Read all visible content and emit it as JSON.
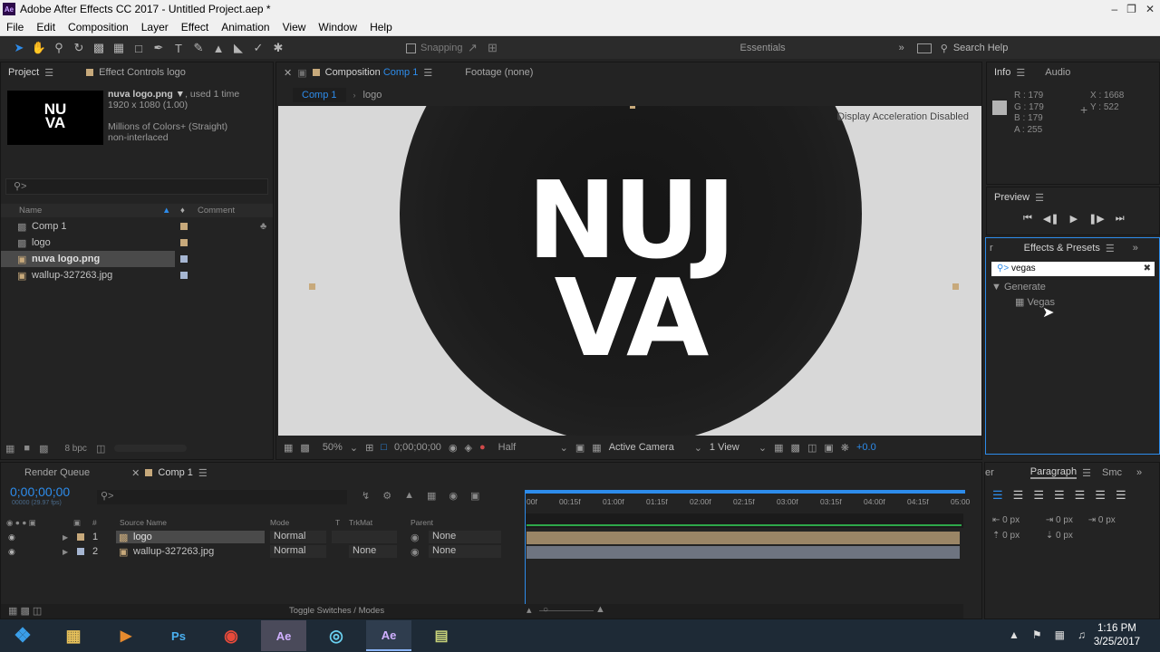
{
  "window": {
    "title": "Adobe After Effects CC 2017 - Untitled Project.aep *",
    "app_icon": "Ae"
  },
  "menu": [
    "File",
    "Edit",
    "Composition",
    "Layer",
    "Effect",
    "Animation",
    "View",
    "Window",
    "Help"
  ],
  "toolbar": {
    "snapping": "Snapping",
    "workspace": "Essentials",
    "search_help": "Search Help"
  },
  "project": {
    "tab": "Project",
    "effect_controls_tab": "Effect Controls logo",
    "thumb_text": [
      "NU",
      "VA"
    ],
    "file_name": "nuva logo.png",
    "used": ", used 1 time",
    "dims": "1920 x 1080 (1.00)",
    "colors": "Millions of Colors+ (Straight)",
    "interlace": "non-interlaced",
    "search_placeholder": "",
    "col_name": "Name",
    "col_comment": "Comment",
    "items": [
      {
        "name": "Comp 1",
        "color": "#c7a97b",
        "selected": false
      },
      {
        "name": "logo",
        "color": "#c7a97b",
        "selected": false
      },
      {
        "name": "nuva logo.png",
        "color": "#a6b6d2",
        "selected": true
      },
      {
        "name": "wallup-327263.jpg",
        "color": "#a6b6d2",
        "selected": false
      }
    ],
    "bpc": "8 bpc"
  },
  "composition": {
    "tab_prefix": "Composition",
    "tab_name": "Comp 1",
    "footage_tab": "Footage (none)",
    "crumb1": "Comp 1",
    "crumb2": "logo",
    "display_msg": "Display Acceleration Disabled",
    "logo_line1": "NUJ",
    "logo_line2": "VA",
    "zoom": "50%",
    "timecode": "0;00;00;00",
    "resolution": "Half",
    "camera": "Active Camera",
    "view": "1 View",
    "exposure": "+0.0"
  },
  "info": {
    "tab": "Info",
    "audio_tab": "Audio",
    "r": "R : 179",
    "g": "G : 179",
    "b": "B : 179",
    "a": "A : 255",
    "x": "X : 1668",
    "y": "Y : 522"
  },
  "preview": {
    "tab": "Preview"
  },
  "effects": {
    "tab": "Effects & Presets",
    "left_tab_fragment": "r",
    "search_value": "vegas",
    "category": "Generate",
    "item": "Vegas"
  },
  "timeline": {
    "render_tab": "Render Queue",
    "comp_tab": "Comp 1",
    "timecode": "0;00;00;00",
    "fps": "00000 (29.97 fps)",
    "ticks": [
      "00f",
      "00:15f",
      "01:00f",
      "01:15f",
      "02:00f",
      "02:15f",
      "03:00f",
      "03:15f",
      "04:00f",
      "04:15f",
      "05:00"
    ],
    "cols": {
      "hash": "#",
      "source": "Source Name",
      "mode": "Mode",
      "t": "T",
      "trkmat": "TrkMat",
      "parent": "Parent"
    },
    "layers": [
      {
        "num": "1",
        "name": "logo",
        "mode": "Normal",
        "trkmat": "",
        "parent": "None",
        "color": "#c7a97b"
      },
      {
        "num": "2",
        "name": "wallup-327263.jpg",
        "mode": "Normal",
        "trkmat": "None",
        "parent": "None",
        "color": "#a6b6d2"
      }
    ],
    "toggle": "Toggle Switches / Modes"
  },
  "paragraph": {
    "tab": "Paragraph",
    "smc_tab": "Smc",
    "left_fragment": "er",
    "values": [
      "0 px",
      "0 px",
      "0 px",
      "0 px",
      "0 px"
    ]
  },
  "taskbar": {
    "apps": [
      "Ps",
      "Ae",
      "Ae"
    ],
    "time": "1:16 PM",
    "date": "3/25/2017"
  },
  "colors": {
    "accent": "#2d8ceb",
    "panel": "#232323",
    "label_tan": "#c7a97b",
    "label_blue": "#a6b6d2"
  }
}
